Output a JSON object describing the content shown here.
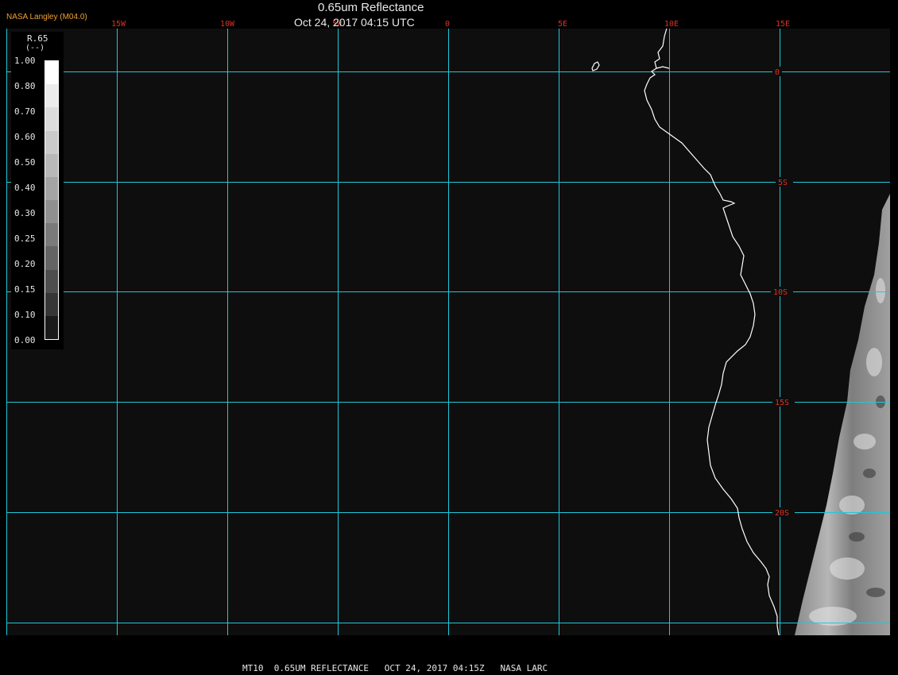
{
  "header": {
    "title": "0.65um Reflectance",
    "subtitle": "Oct 24, 2017 04:15 UTC",
    "producer": "NASA Langley (M04.0)"
  },
  "legend": {
    "title": "R.65",
    "units": "(--)",
    "ticks": [
      "1.00",
      "0.80",
      "0.70",
      "0.60",
      "0.50",
      "0.40",
      "0.30",
      "0.25",
      "0.20",
      "0.15",
      "0.10",
      "0.00"
    ],
    "colors": [
      "#ffffff",
      "#ececec",
      "#dcdcdc",
      "#cacaca",
      "#b8b8b8",
      "#a4a4a4",
      "#909090",
      "#7a7a7a",
      "#646464",
      "#4e4e4e",
      "#363636",
      "#1a1a1a"
    ]
  },
  "grid": {
    "lon_labels": [
      "15W",
      "10W",
      "5W",
      "0",
      "5E",
      "10E",
      "15E"
    ],
    "lat_labels": [
      "0",
      "5S",
      "10S",
      "15S",
      "20S"
    ],
    "line_color": "#1fc8d8",
    "label_color": "#e03020"
  },
  "footer": {
    "text": "MT10  0.65UM REFLECTANCE   OCT 24, 2017 04:15Z   NASA LARC"
  }
}
